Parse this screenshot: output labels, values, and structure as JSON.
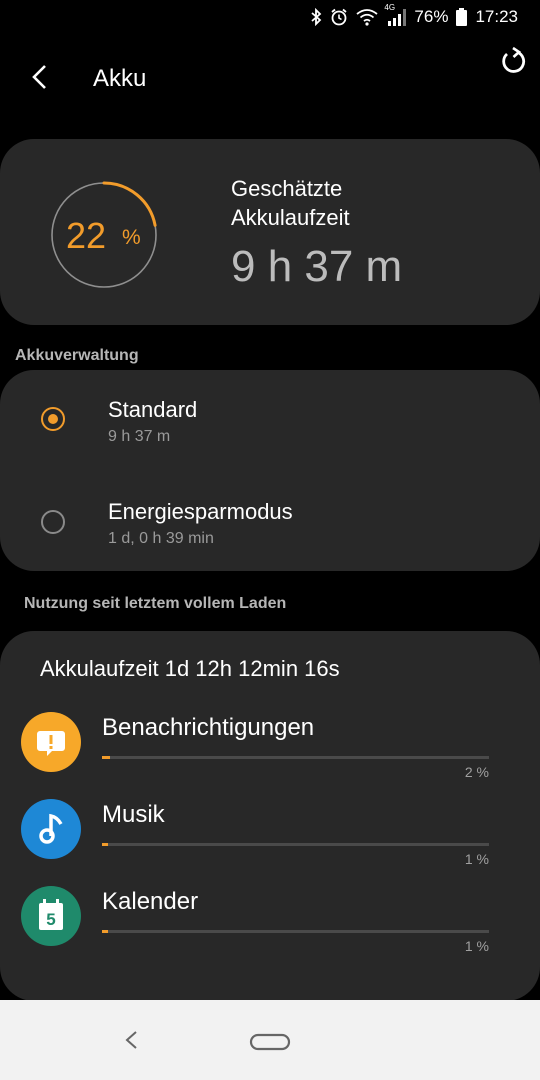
{
  "status_bar": {
    "battery": "76%",
    "time": "17:23",
    "network": "4G"
  },
  "header": {
    "title": "Akku"
  },
  "estimate": {
    "percent": "22",
    "percent_unit": "%",
    "level_fraction": 0.22,
    "label": "Geschätzte Akkulaufzeit",
    "value": "9 h 37 m"
  },
  "management": {
    "section_label": "Akkuverwaltung",
    "modes": [
      {
        "name": "Standard",
        "sub": "9 h 37 m",
        "selected": true
      },
      {
        "name": "Energiesparmodus",
        "sub": "1 d, 0 h 39 min",
        "selected": false
      }
    ]
  },
  "usage": {
    "section_label": "Nutzung seit letztem vollem Laden",
    "title": "Akkulaufzeit 1d 12h 12min 16s",
    "apps": [
      {
        "name": "Benachrichtigungen",
        "percent": "2 %",
        "share": 0.02,
        "icon": "notification-alert-icon",
        "color": "#f7a829"
      },
      {
        "name": "Musik",
        "percent": "1 %",
        "share": 0.01,
        "icon": "music-note-icon",
        "color": "#1e88d6"
      },
      {
        "name": "Kalender",
        "percent": "1 %",
        "share": 0.01,
        "icon": "calendar-icon",
        "color": "#1f8a6b",
        "calendar_day": "5"
      }
    ]
  },
  "colors": {
    "accent": "#f29c2b",
    "card": "#282828",
    "background": "#000000"
  }
}
